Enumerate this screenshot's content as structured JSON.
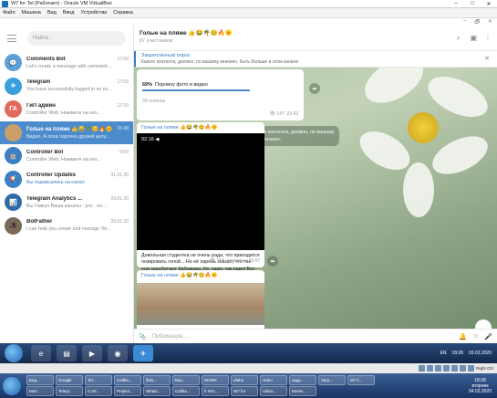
{
  "window": {
    "title": "W7 for Tel (Работает) - Oracle VM VirtualBox",
    "controls": [
      "–",
      "□",
      "✕"
    ]
  },
  "menu": [
    "Файл",
    "Машина",
    "Вид",
    "Ввод",
    "Устройства",
    "Справка"
  ],
  "tg_controls": [
    "–",
    "🗗",
    "✕"
  ],
  "sidebar": {
    "search_placeholder": "Найти...",
    "chats": [
      {
        "name": "Comments Bot",
        "time": "17:09",
        "preview": "Let's create a message with comment...",
        "avatar_color": "#5aa1dc",
        "initials": "💬"
      },
      {
        "name": "Telegram",
        "time": "17:03",
        "preview": "You have successfully logged in on co...",
        "avatar_color": "#37a0dd",
        "initials": "✈"
      },
      {
        "name": "ГиП админ",
        "time": "17:29",
        "preview": "Controller Web: Нажмите на кно...",
        "avatar_color": "#e26a5c",
        "initials": "ГА"
      },
      {
        "name": "Голые на пляже 👍😂🌴😊🔥🌞",
        "time": "15:48",
        "preview": "Видео, А пока парочка друзей целу...",
        "avatar_color": "#c9a06a",
        "initials": ""
      },
      {
        "name": "Controller Bot",
        "time": "0:50",
        "preview": "Controller Web: Нажмите на кно...",
        "avatar_color": "#3a80c6",
        "initials": "🤖"
      },
      {
        "name": "Controller Updates",
        "time": "31.01.20",
        "preview": "Вы подписались на канал",
        "avatar_color": "#3a80c6",
        "initials": "📢"
      },
      {
        "name": "Telegram Analytics ...",
        "time": "29.01.20",
        "preview": "Вы Гавкул Ваши каналы : упс.. он...",
        "avatar_color": "#2e6aa8",
        "initials": "📊"
      },
      {
        "name": "BotFather",
        "time": "29.01.20",
        "preview": "I can help you create and manage Tel...",
        "avatar_color": "#7a6a5a",
        "initials": "🎩"
      }
    ]
  },
  "chat": {
    "title": "Голые на пляже 👍😂🌴😊🔥🌞",
    "subtitle": "87 участников",
    "pinned_title": "Закреплённый опрос",
    "pinned_text": "Какого контента, должно, по вашему мнению, быть больше в этом канале",
    "poll": {
      "percent": "69%",
      "option": "Поровну фото и видео",
      "votes": "39 голосов",
      "views": "147",
      "time": "23:43",
      "fraction": 0.69
    },
    "service": "«Голые на пляже 👍😂🌴😊🔥🌞» закрепил(а) «Какого контента, должно, по вашему мнению, быть больше в этом канале»",
    "msg1": {
      "sender": "Голые на пляже 👍😂🌴😊🔥🌞",
      "duration": "02:16 ◀",
      "caption": "Довольная студентка не очень рада, что приходится позировать голой... Но её парень сказал, что так они заработают бабнишка. Ну, надо, так надо! Вот вам - смотрите на мою аппетитную..... 😏",
      "views": "154",
      "edited": "изменено 23:47"
    },
    "msg2": {
      "sender": "Голые на пляже 👍😂🌴😊🔥🌞"
    },
    "composer_placeholder": "Публикация..."
  },
  "taskbar": {
    "lang": "EN",
    "time": "18:28",
    "date": "03.02.2020",
    "host_key": "Right Ctrl"
  },
  "host_taskbar": {
    "tasks": [
      "Бед...",
      "Google",
      "Tel...",
      "Callba...",
      "ifwh...",
      "Вах...",
      "WORK",
      "ufaho",
      "video",
      "кадр...",
      "Загр...",
      "W7 f...",
      "MSc...",
      "Telegr...",
      "Conf...",
      "Project...",
      "Whats...",
      "Callba...",
      "Il Stro...",
      "W7 for",
      "Video...",
      "Movie..."
    ],
    "time": "18:28",
    "day": "вторник",
    "date": "04.02.2020"
  }
}
